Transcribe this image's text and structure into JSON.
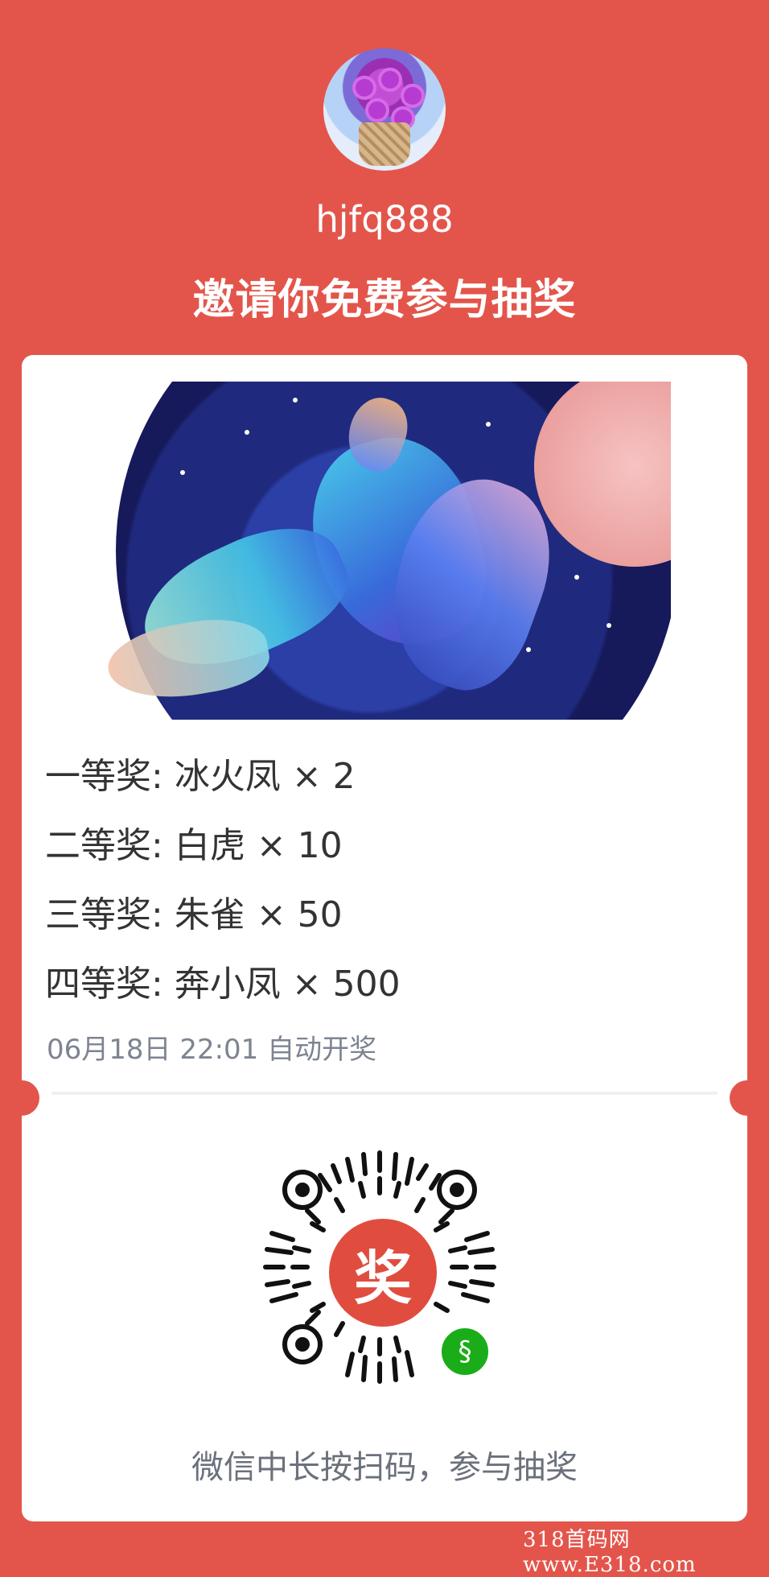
{
  "header": {
    "username": "hjfq888",
    "invite_text": "邀请你免费参与抽奖"
  },
  "prizes": [
    {
      "level": "一等奖:",
      "item": "冰火凤 × 2"
    },
    {
      "level": "二等奖:",
      "item": "白虎 × 10"
    },
    {
      "level": "三等奖:",
      "item": "朱雀 × 50"
    },
    {
      "level": "四等奖:",
      "item": "奔小凤 × 500"
    }
  ],
  "draw_time": "06月18日 22:01 自动开奖",
  "qr": {
    "center_char": "奖"
  },
  "hint": "微信中长按扫码，参与抽奖",
  "watermark": "318首码网 www.E318.com",
  "colors": {
    "background": "#e3554b",
    "card": "#ffffff",
    "qr_center": "#e04d3f",
    "wechat_badge": "#1aad19"
  }
}
